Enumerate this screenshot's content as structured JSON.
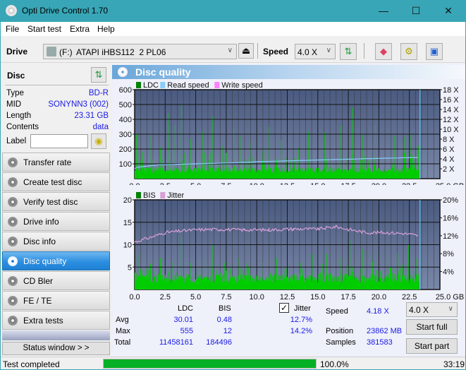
{
  "window": {
    "title": "Opti Drive Control 1.70",
    "minimize": "—",
    "maximize": "☐",
    "close": "✕"
  },
  "menu": [
    "File",
    "Start test",
    "Extra",
    "Help"
  ],
  "toolbar": {
    "drive_label": "Drive",
    "drive_letter": "(F:)",
    "drive_name": "ATAPI iHBS112  2 PL06",
    "speed_label": "Speed",
    "speed_value": "4.0 X"
  },
  "disc": {
    "header": "Disc",
    "rows": [
      {
        "label": "Type",
        "value": "BD-R"
      },
      {
        "label": "MID",
        "value": "SONYNN3 (002)"
      },
      {
        "label": "Length",
        "value": "23.31 GB"
      },
      {
        "label": "Contents",
        "value": "data"
      }
    ],
    "label_field_label": "Label",
    "label_value": ""
  },
  "nav": [
    {
      "label": "Transfer rate",
      "active": false
    },
    {
      "label": "Create test disc",
      "active": false
    },
    {
      "label": "Verify test disc",
      "active": false
    },
    {
      "label": "Drive info",
      "active": false
    },
    {
      "label": "Disc info",
      "active": false
    },
    {
      "label": "Disc quality",
      "active": true
    },
    {
      "label": "CD Bler",
      "active": false
    },
    {
      "label": "FE / TE",
      "active": false
    },
    {
      "label": "Extra tests",
      "active": false
    }
  ],
  "status_window_btn": "Status window > >",
  "panel_title": "Disc quality",
  "colors": {
    "ldc": "#008000",
    "read_speed": "#87cefa",
    "write_speed": "#ff80ff",
    "bis": "#008000",
    "jitter": "#d8a0d8",
    "bar_fill": "#00cc00",
    "plot_bg_top": "#4a5a80",
    "plot_bg_bottom": "#7a88a8",
    "progress": "#06b025"
  },
  "chart_data": [
    {
      "type": "bar",
      "title": "LDC / Read speed",
      "legend": [
        "LDC",
        "Read speed",
        "Write speed"
      ],
      "legend_position": "top-left",
      "xlabel": "GB",
      "x_ticks": [
        "0.0",
        "2.5",
        "5.0",
        "7.5",
        "10.0",
        "12.5",
        "15.0",
        "17.5",
        "20.0",
        "22.5",
        "25.0 GB"
      ],
      "xlim": [
        0,
        25
      ],
      "y_ticks": [
        "100",
        "200",
        "300",
        "400",
        "500",
        "600"
      ],
      "ylim": [
        0,
        600
      ],
      "y2_ticks": [
        "2 X",
        "4 X",
        "6 X",
        "8 X",
        "10 X",
        "12 X",
        "14 X",
        "16 X",
        "18 X"
      ],
      "y2lim": [
        0,
        18
      ],
      "grid": true,
      "data_end_gb": 23.31,
      "ldc_baseline_approx": 40,
      "ldc_peaks": [
        [
          0.1,
          300
        ],
        [
          0.6,
          180
        ],
        [
          1.3,
          290
        ],
        [
          2.1,
          210
        ],
        [
          2.7,
          440
        ],
        [
          3.3,
          360
        ],
        [
          3.8,
          500
        ],
        [
          4.5,
          270
        ],
        [
          5.5,
          320
        ],
        [
          6.4,
          420
        ],
        [
          7.2,
          220
        ],
        [
          8.1,
          340
        ],
        [
          8.6,
          290
        ],
        [
          9.5,
          250
        ],
        [
          10.4,
          200
        ],
        [
          11.0,
          350
        ],
        [
          12.0,
          260
        ],
        [
          13.4,
          210
        ],
        [
          14.2,
          320
        ],
        [
          15.5,
          310
        ],
        [
          16.9,
          360
        ],
        [
          17.8,
          480
        ],
        [
          18.6,
          300
        ],
        [
          19.7,
          360
        ],
        [
          21.3,
          290
        ],
        [
          22.1,
          280
        ],
        [
          22.6,
          300
        ],
        [
          23.2,
          220
        ]
      ],
      "read_speed": {
        "x": [
          0,
          0.2,
          2,
          5,
          8,
          11,
          14,
          17,
          20,
          23.3
        ],
        "y": [
          2.0,
          2.3,
          2.8,
          3.0,
          3.2,
          3.5,
          3.7,
          3.9,
          4.1,
          4.3
        ]
      }
    },
    {
      "type": "bar",
      "title": "BIS / Jitter",
      "legend": [
        "BIS",
        "Jitter"
      ],
      "legend_position": "top-left",
      "xlabel": "GB",
      "x_ticks": [
        "0.0",
        "2.5",
        "5.0",
        "7.5",
        "10.0",
        "12.5",
        "15.0",
        "17.5",
        "20.0",
        "22.5",
        "25.0 GB"
      ],
      "xlim": [
        0,
        25
      ],
      "y_ticks": [
        "5",
        "10",
        "15",
        "20"
      ],
      "ylim": [
        0,
        20
      ],
      "y2_ticks": [
        "4%",
        "8%",
        "12%",
        "16%",
        "20%"
      ],
      "y2lim": [
        0,
        20
      ],
      "grid": true,
      "data_end_gb": 23.31,
      "bis_peaks": [
        [
          0.2,
          8
        ],
        [
          1.2,
          6
        ],
        [
          2.1,
          7
        ],
        [
          3.0,
          6
        ],
        [
          3.8,
          12
        ],
        [
          4.5,
          6
        ],
        [
          5.6,
          7
        ],
        [
          6.4,
          10
        ],
        [
          7.3,
          6
        ],
        [
          8.4,
          7
        ],
        [
          9.2,
          6
        ],
        [
          10.5,
          6
        ],
        [
          11.6,
          7
        ],
        [
          12.4,
          5
        ],
        [
          13.6,
          6
        ],
        [
          14.6,
          8
        ],
        [
          15.7,
          8
        ],
        [
          16.8,
          7
        ],
        [
          17.7,
          11
        ],
        [
          18.6,
          9
        ],
        [
          19.5,
          8
        ],
        [
          20.7,
          8
        ],
        [
          21.5,
          8
        ],
        [
          22.4,
          10
        ],
        [
          23.1,
          7
        ]
      ],
      "jitter": {
        "x": [
          0,
          0.5,
          1.5,
          2.5,
          4,
          5.5,
          7,
          9,
          11,
          13,
          15,
          16.5,
          17.5,
          19,
          20.5,
          22,
          23.3
        ],
        "y": [
          10.6,
          11.0,
          11.8,
          12.7,
          13.1,
          13.4,
          13.4,
          13.3,
          13.3,
          13.5,
          13.5,
          14.0,
          13.4,
          12.7,
          12.7,
          12.5,
          12.0
        ]
      }
    }
  ],
  "stats": {
    "col_ldc": "LDC",
    "col_bis": "BIS",
    "jitter_checked": true,
    "jitter_label": "Jitter",
    "rows": [
      {
        "label": "Avg",
        "ldc": "30.01",
        "bis": "0.48",
        "jitter": "12.7%"
      },
      {
        "label": "Max",
        "ldc": "555",
        "bis": "12",
        "jitter": "14.2%"
      },
      {
        "label": "Total",
        "ldc": "11458161",
        "bis": "184496",
        "jitter": ""
      }
    ],
    "speed_label": "Speed",
    "speed_value": "4.18 X",
    "position_label": "Position",
    "position_value": "23862 MB",
    "samples_label": "Samples",
    "samples_value": "381583",
    "speed_select": "4.0 X",
    "start_full": "Start full",
    "start_part": "Start part"
  },
  "status": {
    "text": "Test completed",
    "progress": 100.0,
    "progress_text": "100.0%",
    "time": "33:19"
  }
}
